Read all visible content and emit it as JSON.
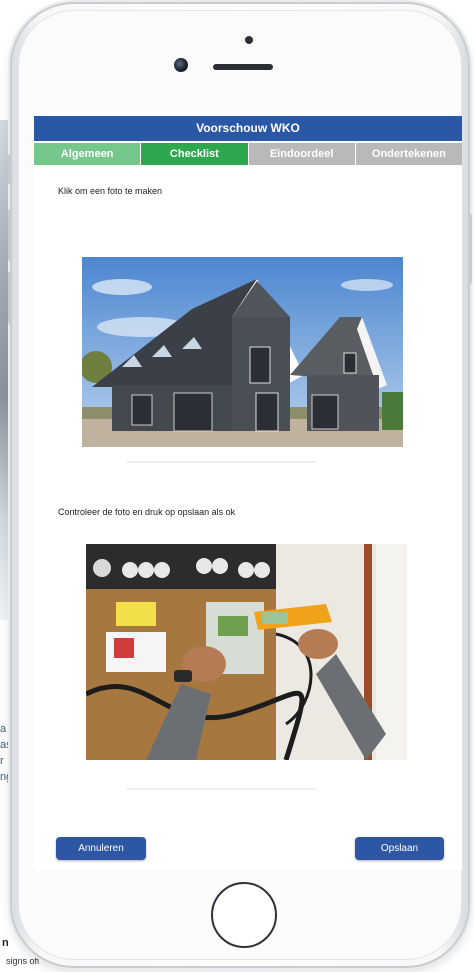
{
  "app": {
    "title": "Voorschouw WKO"
  },
  "tabs": [
    {
      "label": "Algemeen",
      "state": "done"
    },
    {
      "label": "Checklist",
      "state": "active"
    },
    {
      "label": "Eindoordeel",
      "state": "pending"
    },
    {
      "label": "Ondertekenen",
      "state": "pending"
    }
  ],
  "instructions": {
    "take_photo": "Klik om een foto te maken",
    "check_photo": "Controleer de foto en druk op opslaan als ok"
  },
  "photos": [
    {
      "subject": "house-exterior"
    },
    {
      "subject": "electrician-measuring-meter-cabinet"
    }
  ],
  "buttons": {
    "cancel": "Annuleren",
    "save": "Opslaan"
  },
  "background": {
    "side_text": [
      "a",
      "as",
      "r",
      "ng"
    ],
    "bottom_letter": "n",
    "bottom_text": "signs off"
  },
  "colors": {
    "header_blue": "#2a57a6",
    "tab_done": "#76c78b",
    "tab_active": "#2ea84f",
    "tab_pending": "#b7b9bb",
    "button_blue": "#2d56a5"
  }
}
